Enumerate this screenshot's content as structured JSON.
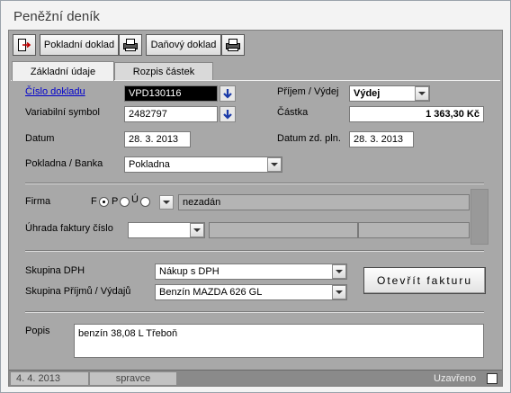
{
  "window": {
    "title": "Peněžní deník"
  },
  "toolbar": {
    "pokladni_doklad": "Pokladní doklad",
    "danovy_doklad": "Daňový doklad"
  },
  "tabs": [
    {
      "label": "Základní údaje",
      "active": true
    },
    {
      "label": "Rozpis částek",
      "active": false
    }
  ],
  "form": {
    "cislo_dokladu_label": "Číslo dokladu",
    "cislo_dokladu_value": "VPD130116",
    "variabilni_symbol_label": "Variabilní symbol",
    "variabilni_symbol_value": "2482797",
    "datum_label": "Datum",
    "datum_value": "28. 3. 2013",
    "pokladna_banka_label": "Pokladna / Banka",
    "pokladna_banka_value": "Pokladna",
    "prijem_vydej_label": "Příjem / Výdej",
    "prijem_vydej_value": "Výdej",
    "castka_label": "Částka",
    "castka_value": "1 363,30 Kč",
    "datum_zd_pln_label": "Datum zd. pln.",
    "datum_zd_pln_value": "28. 3. 2013",
    "firma_label": "Firma",
    "firma_radio_f": "F",
    "firma_radio_p": "P",
    "firma_radio_u": "Ú",
    "firma_value": "nezadán",
    "uhrada_label": "Úhrada faktury číslo",
    "skupina_dph_label": "Skupina DPH",
    "skupina_dph_value": "Nákup s DPH",
    "skupina_prijmu_label": "Skupina Příjmů / Výdajů",
    "skupina_prijmu_value": "Benzín MAZDA 626 GL",
    "otevrit_fakturu": "Otevřít fakturu",
    "popis_label": "Popis",
    "popis_value": "benzín  38,08 L  Třeboň"
  },
  "status": {
    "date": "4. 4. 2013",
    "user": "spravce",
    "uzavreno": "Uzavřeno"
  },
  "colors": {
    "accent_link": "#0000cc",
    "panel": "#a8a8a8"
  }
}
